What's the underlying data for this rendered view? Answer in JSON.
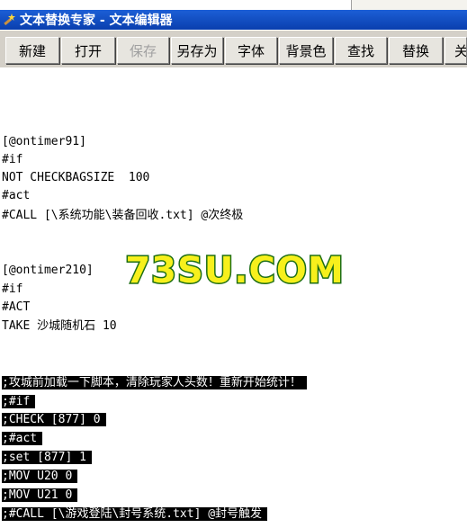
{
  "window": {
    "title": "文本替换专家 - 文本编辑器",
    "icon": "magic-wand-icon"
  },
  "toolbar": {
    "buttons": [
      {
        "label": "新建",
        "enabled": true
      },
      {
        "label": "打开",
        "enabled": true
      },
      {
        "label": "保存",
        "enabled": false
      },
      {
        "label": "另存为",
        "enabled": true
      },
      {
        "label": "字体",
        "enabled": true
      },
      {
        "label": "背景色",
        "enabled": true
      },
      {
        "label": "查找",
        "enabled": true
      },
      {
        "label": "替换",
        "enabled": true
      },
      {
        "label": "关",
        "enabled": true
      }
    ]
  },
  "editor": {
    "lines": [
      "[@ontimer91]",
      "#if",
      "NOT CHECKBAGSIZE  100",
      "#act",
      "#CALL [\\系统功能\\装备回收.txt] @次终极",
      "[@ontimer210]",
      "#if",
      "#ACT",
      "TAKE 沙城随机石 10",
      ";攻城前加载一下脚本，清除玩家人头数！重新开始统计！",
      ";#if",
      ";CHECK [877] 0",
      ";#act",
      ";set [877] 1",
      ";MOV U20 0",
      ";MOV U21 0",
      ";#CALL [\\游戏登陆\\封号系统.txt] @封号触发"
    ]
  },
  "watermark": {
    "text": "73SU.COM",
    "fill_color": "#f7f01c",
    "outline_color": "#1d6e14"
  }
}
